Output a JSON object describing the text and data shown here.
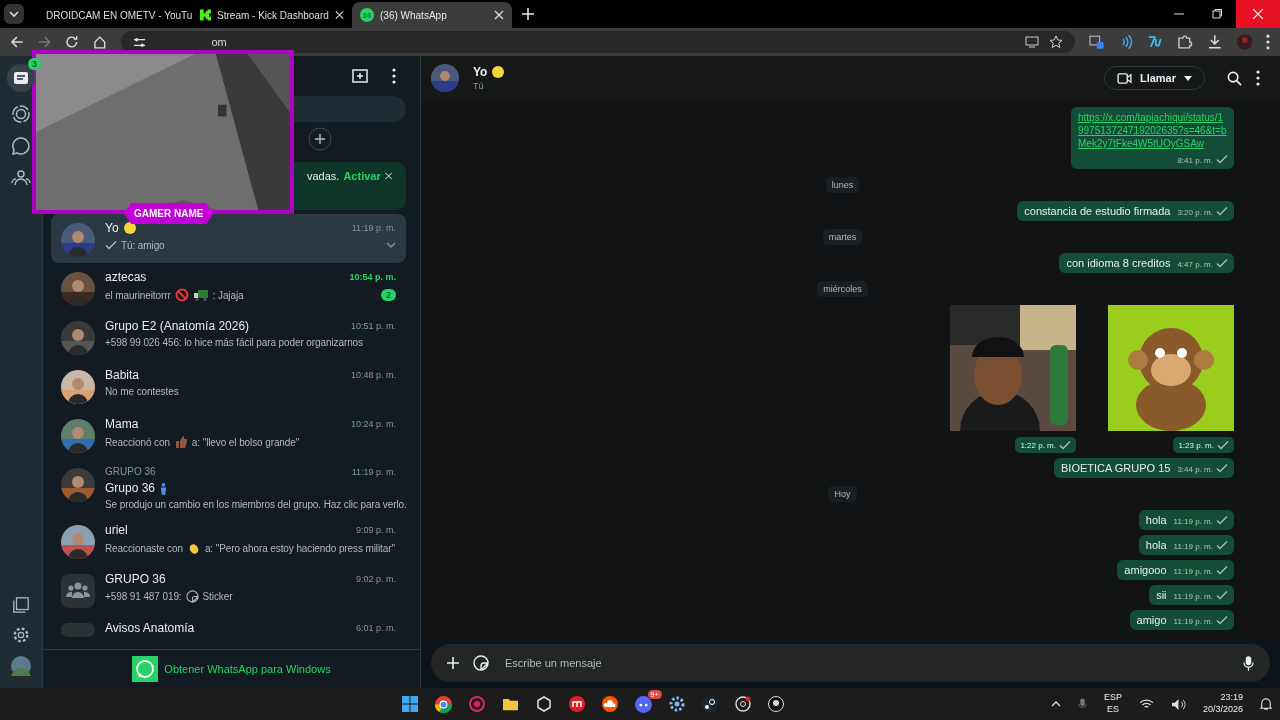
{
  "browser": {
    "tabs": [
      {
        "title": "DROIDCAM EN OMETV - YouTu",
        "selected": false
      },
      {
        "title": "Stream - Kick Dashboard",
        "selected": false
      },
      {
        "title": "(36) WhatsApp",
        "favicon_text": "36",
        "selected": true
      }
    ],
    "address": "om"
  },
  "overlay": {
    "label": "GAMER NAME"
  },
  "rail": {
    "badge": "3"
  },
  "banner": {
    "text": "vadas.",
    "link": "Activar"
  },
  "chats": [
    {
      "kind": "contact",
      "name": "Yo",
      "name_marks": [
        {
          "kind": "dot"
        }
      ],
      "parts": [
        {
          "kind": "check"
        },
        {
          "kind": "text",
          "text": "Tú: amigo"
        }
      ],
      "time": "11:19 p. m.",
      "unread": false,
      "selected": true
    },
    {
      "kind": "contact",
      "name": "aztecas",
      "parts": [
        {
          "kind": "text",
          "text": "el maurineitorrr"
        },
        {
          "kind": "prohibited"
        },
        {
          "kind": "truck"
        },
        {
          "kind": "text",
          "text": ": Jajaja"
        }
      ],
      "time": "10:54 p. m.",
      "unread": true,
      "badge": "2",
      "selected": false
    },
    {
      "kind": "contact",
      "name": "Grupo E2 (Anatomía 2026)",
      "parts": [
        {
          "kind": "text",
          "text": "+598 99 026 456: lo hice más fácil para poder organizarnos"
        }
      ],
      "time": "10:51 p. m.",
      "unread": false,
      "selected": false
    },
    {
      "kind": "contact",
      "name": "Babita",
      "parts": [
        {
          "kind": "text",
          "text": "No me contestes"
        }
      ],
      "time": "10:48 p. m.",
      "unread": false,
      "selected": false
    },
    {
      "kind": "contact",
      "name": "Mama",
      "parts": [
        {
          "kind": "text",
          "text": "Reaccionó con"
        },
        {
          "kind": "thumb"
        },
        {
          "kind": "text",
          "text": "a: \"llevo el bolso grande\""
        }
      ],
      "time": "10:24 p. m.",
      "unread": false,
      "selected": false
    },
    {
      "kind": "contact",
      "group": "GRUPO 36",
      "name": "Grupo 36",
      "name_marks": [
        {
          "kind": "figure"
        }
      ],
      "parts": [
        {
          "kind": "text",
          "text": "Se produjo un cambio en los miembros del grupo. Haz clic para verlo."
        }
      ],
      "time": "11:19 p. m.",
      "unread": false,
      "selected": false
    },
    {
      "kind": "contact",
      "name": "uriel",
      "parts": [
        {
          "kind": "text",
          "text": "Reaccionaste con"
        },
        {
          "kind": "clap"
        },
        {
          "kind": "text",
          "text": "a: \"Pero ahora estoy haciendo press militar\""
        }
      ],
      "time": "9:09 p. m.",
      "unread": false,
      "selected": false
    },
    {
      "kind": "group",
      "name": "GRUPO 36",
      "parts": [
        {
          "kind": "text",
          "text": "+598 91 487 019:"
        },
        {
          "kind": "sticker"
        },
        {
          "kind": "text",
          "text": "Sticker"
        }
      ],
      "time": "9:02 p. m.",
      "unread": false,
      "selected": false
    },
    {
      "kind": "cut",
      "name": "Avisos Anatomía",
      "time": "6:01 p. m.",
      "unread": false,
      "selected": false
    }
  ],
  "get_app": "Obtener WhatsApp para Windows",
  "header": {
    "name": "Yo",
    "status": "Tú",
    "call": "Llamar"
  },
  "messages": [
    {
      "kind": "link",
      "text": "https://x.com/tapiachiqui/status/1997513724719202635?s=46&t=bMek2y7tFke4W5tUOyGSAw",
      "time": "8:41 p. m."
    },
    {
      "kind": "date",
      "text": "lunes"
    },
    {
      "kind": "text",
      "text": "constancia de estudio firmada",
      "time": "3:20 p. m."
    },
    {
      "kind": "date",
      "text": "martes"
    },
    {
      "kind": "text",
      "text": "con idioma 8 creditos",
      "time": "4:47 p. m."
    },
    {
      "kind": "date",
      "text": "miércoles"
    },
    {
      "kind": "media",
      "items": [
        {
          "kind": "picture",
          "time": "1:22 p. m."
        },
        {
          "kind": "picture",
          "time": "1:23 p. m."
        }
      ]
    },
    {
      "kind": "text",
      "text": "BIOETICA GRUPO 15",
      "time": "3:44 p. m."
    },
    {
      "kind": "date",
      "text": "Hoy"
    },
    {
      "kind": "text",
      "text": "hola",
      "time": "11:19 p. m."
    },
    {
      "kind": "text",
      "text": "hola",
      "time": "11:19 p. m."
    },
    {
      "kind": "text",
      "text": "amigooo",
      "time": "11:19 p. m."
    },
    {
      "kind": "text",
      "text": "sii",
      "time": "11:19 p. m."
    },
    {
      "kind": "text",
      "text": "amigo",
      "time": "11:19 p. m."
    }
  ],
  "composer": {
    "placeholder": "Escribe un mensaje"
  },
  "taskbar": {
    "discord_badge": "9+",
    "lang": "ESP",
    "region": "ES",
    "time": "23:19",
    "date": "20/3/2026"
  }
}
